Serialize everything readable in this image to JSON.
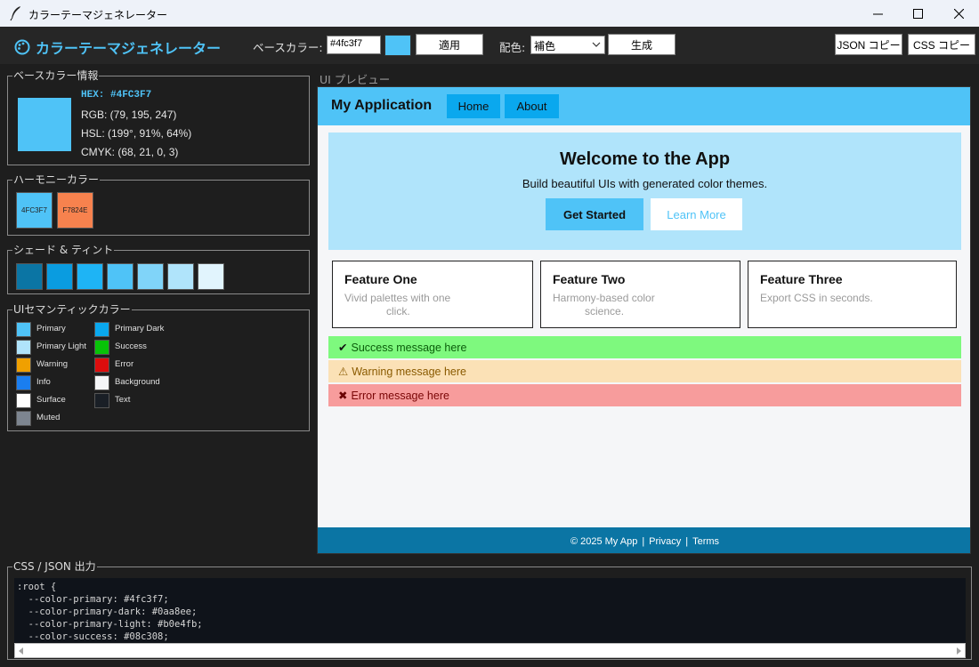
{
  "window": {
    "title": "カラーテーマジェネレーター"
  },
  "toolbar": {
    "app_title": "カラーテーマジェネレーター",
    "base_color_label": "ベースカラー:",
    "base_color_value": "#4fc3f7",
    "apply_label": "適用",
    "scheme_label": "配色:",
    "scheme_value": "補色",
    "generate_label": "生成",
    "json_copy_label": "JSON コピー",
    "css_copy_label": "CSS コピー"
  },
  "base_info": {
    "title": "ベースカラー情報",
    "color": "#4fc3f7",
    "hex": "HEX: #4FC3F7",
    "rgb": "RGB: (79, 195, 247)",
    "hsl": "HSL: (199°, 91%, 64%)",
    "cmyk": "CMYK: (68, 21, 0, 3)"
  },
  "harmony": {
    "title": "ハーモニーカラー",
    "colors": [
      {
        "label": "4FC3F7",
        "color": "#4fc3f7"
      },
      {
        "label": "F7824E",
        "color": "#f7824e"
      }
    ]
  },
  "shades": {
    "title": "シェード & ティント",
    "colors": [
      "#0b75a4",
      "#0a9ce0",
      "#1eb4f5",
      "#4fc3f7",
      "#80d4f9",
      "#b0e4fb",
      "#e1f4fd"
    ]
  },
  "semantic": {
    "title": "UIセマンティックカラー",
    "items": [
      {
        "label": "Primary",
        "color": "#4fc3f7"
      },
      {
        "label": "Primary Dark",
        "color": "#0aa8ee"
      },
      {
        "label": "Primary Light",
        "color": "#b0e4fb"
      },
      {
        "label": "Success",
        "color": "#08c308"
      },
      {
        "label": "Warning",
        "color": "#f0a000"
      },
      {
        "label": "Error",
        "color": "#dd0d0d"
      },
      {
        "label": "Info",
        "color": "#1a7ef0"
      },
      {
        "label": "Background",
        "color": "#f5f6f8"
      },
      {
        "label": "Surface",
        "color": "#ffffff"
      },
      {
        "label": "Text",
        "color": "#1a1f26"
      },
      {
        "label": "Muted",
        "color": "#7d8590"
      }
    ]
  },
  "preview": {
    "label": "UI プレビュー",
    "brand": "My Application",
    "nav": [
      "Home",
      "About"
    ],
    "hero_title": "Welcome to the App",
    "hero_subtitle": "Build beautiful UIs with generated color themes.",
    "cta_primary": "Get Started",
    "cta_secondary": "Learn More",
    "cards": [
      {
        "title": "Feature One",
        "desc_line1": "Vivid palettes with one",
        "desc_line2": "click."
      },
      {
        "title": "Feature Two",
        "desc_line1": "Harmony-based color",
        "desc_line2": "science."
      },
      {
        "title": "Feature Three",
        "desc_line1": "Export CSS in seconds.",
        "desc_line2": ""
      }
    ],
    "alerts": {
      "success": "Success message here",
      "warning": "Warning message here",
      "error": "Error message here"
    },
    "footer": {
      "copyright": "© 2025 My App",
      "sep": "|",
      "privacy": "Privacy",
      "terms": "Terms"
    }
  },
  "output": {
    "title": "CSS / JSON 出力",
    "code": ":root {\n  --color-primary: #4fc3f7;\n  --color-primary-dark: #0aa8ee;\n  --color-primary-light: #b0e4fb;\n  --color-success: #08c308;"
  },
  "colors": {
    "accent": "#4fc3f7",
    "dark_bg": "#1e1e1e"
  }
}
